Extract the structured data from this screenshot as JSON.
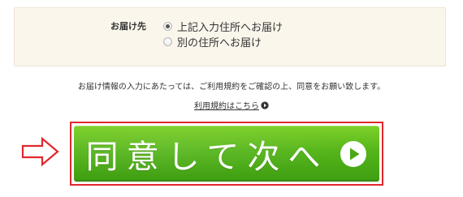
{
  "delivery": {
    "label": "お届け先",
    "options": [
      {
        "label": "上記入力住所へお届け",
        "checked": true
      },
      {
        "label": "別の住所へお届け",
        "checked": false
      }
    ]
  },
  "notice": {
    "text": "お届け情報の入力にあたっては、ご利用規約をご確認の上、同意をお願い致します。"
  },
  "terms_link": {
    "label": "利用規約はこちら"
  },
  "next_button": {
    "label": "同意して次へ"
  },
  "colors": {
    "button_green": "#55b51a",
    "button_border": "#e0282e",
    "arrow_red": "#e0282e",
    "box_background": "#fbf6ec"
  }
}
